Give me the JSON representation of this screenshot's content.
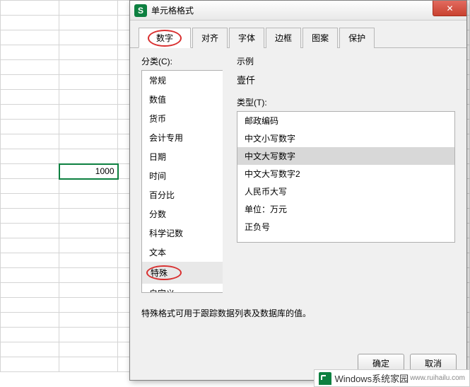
{
  "cell": {
    "value": "1000"
  },
  "dialog": {
    "title": "单元格格式",
    "app_icon_letter": "S",
    "close_glyph": "✕",
    "tabs": {
      "number": "数字",
      "align": "对齐",
      "font": "字体",
      "border": "边框",
      "pattern": "图案",
      "protect": "保护"
    },
    "category_label": "分类(C):",
    "categories": {
      "general": "常规",
      "number": "数值",
      "currency": "货币",
      "accounting": "会计专用",
      "date": "日期",
      "time": "时间",
      "percent": "百分比",
      "fraction": "分数",
      "scientific": "科学记数",
      "text": "文本",
      "special": "特殊",
      "custom": "自定义"
    },
    "example_label": "示例",
    "example_value": "壹仟",
    "type_label": "类型(T):",
    "types": {
      "postal": "邮政编码",
      "cn_lower": "中文小写数字",
      "cn_upper": "中文大写数字",
      "cn_upper2": "中文大写数字2",
      "rmb_upper": "人民币大写",
      "unit_wan": "单位：万元",
      "plus_minus": "正负号"
    },
    "description": "特殊格式可用于跟踪数据列表及数据库的值。",
    "ok_label": "确定",
    "cancel_label": "取消"
  },
  "watermark": {
    "text": "indows系统家园",
    "url": "www.ruihailu.com"
  }
}
